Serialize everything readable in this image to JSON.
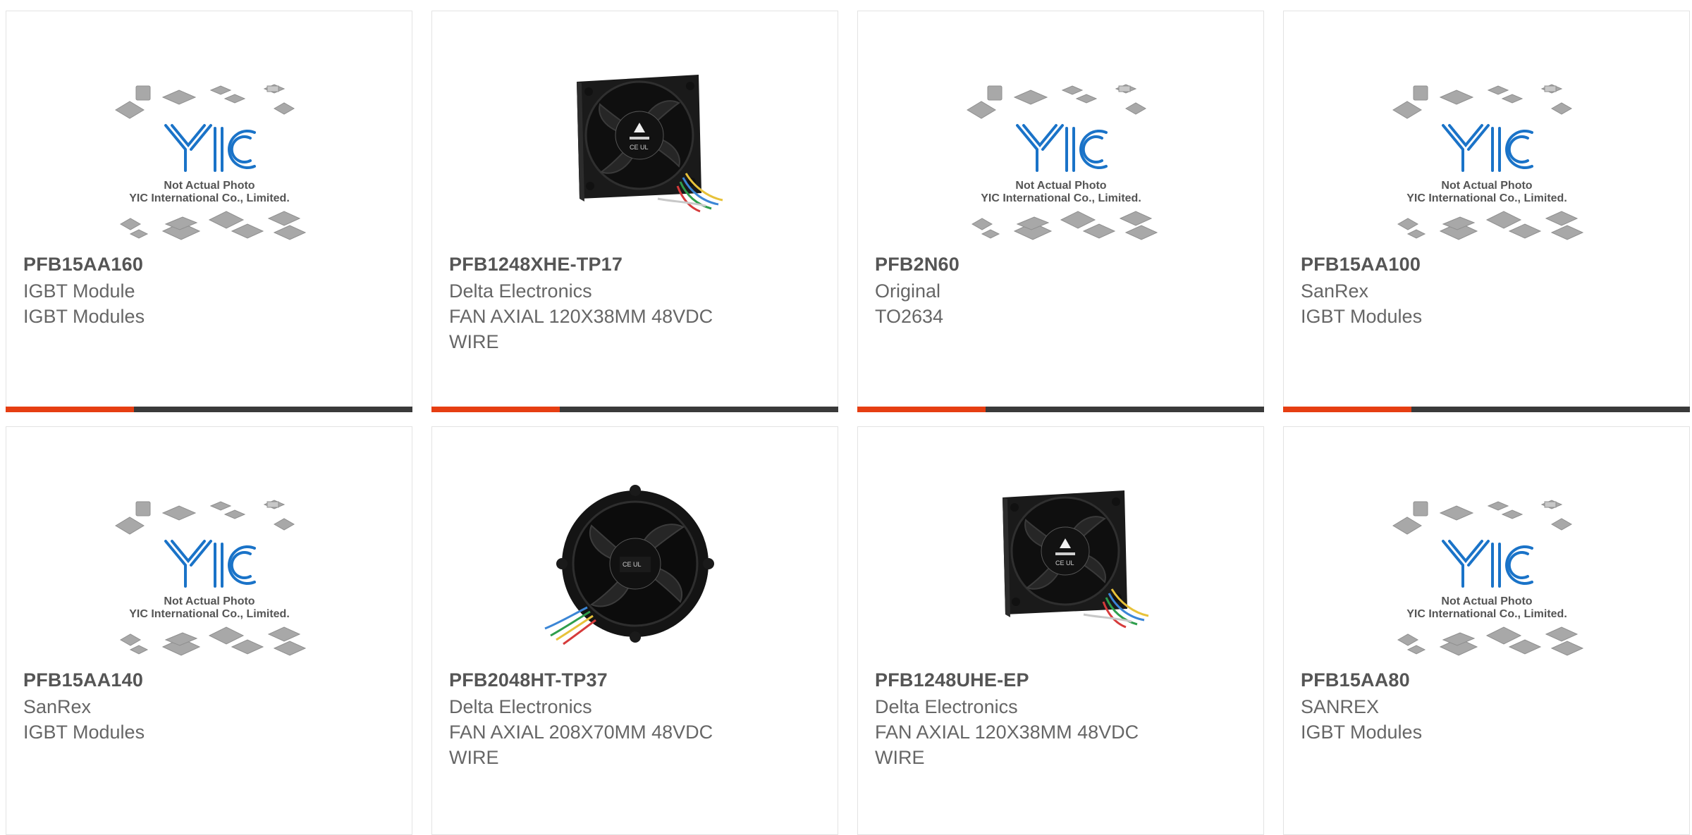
{
  "colors": {
    "accent": "#e63e12",
    "bar": "#3a3a3a",
    "placeholder_logo": "#1a73c8",
    "placeholder_chips": "#a8a8a8"
  },
  "placeholder": {
    "line1": "Not Actual Photo",
    "line2": "YIC International Co., Limited."
  },
  "products": [
    {
      "part": "PFB15AA160",
      "maker": "IGBT Module",
      "desc": "IGBT Modules",
      "desc2": "",
      "image": "placeholder-logo"
    },
    {
      "part": "PFB1248XHE-TP17",
      "maker": "Delta Electronics",
      "desc": "FAN AXIAL 120X38MM 48VDC",
      "desc2": "WIRE",
      "image": "square-fan-icon"
    },
    {
      "part": "PFB2N60",
      "maker": "Original",
      "desc": "TO2634",
      "desc2": "",
      "image": "placeholder-logo"
    },
    {
      "part": "PFB15AA100",
      "maker": "SanRex",
      "desc": "IGBT Modules",
      "desc2": "",
      "image": "placeholder-logo"
    },
    {
      "part": "PFB15AA140",
      "maker": "SanRex",
      "desc": "IGBT Modules",
      "desc2": "",
      "image": "placeholder-logo"
    },
    {
      "part": "PFB2048HT-TP37",
      "maker": "Delta Electronics",
      "desc": "FAN AXIAL 208X70MM 48VDC",
      "desc2": "WIRE",
      "image": "round-fan-icon"
    },
    {
      "part": "PFB1248UHE-EP",
      "maker": "Delta Electronics",
      "desc": "FAN AXIAL 120X38MM 48VDC",
      "desc2": "WIRE",
      "image": "square-fan-icon"
    },
    {
      "part": "PFB15AA80",
      "maker": "SANREX",
      "desc": "IGBT Modules",
      "desc2": "",
      "image": "placeholder-logo"
    }
  ]
}
